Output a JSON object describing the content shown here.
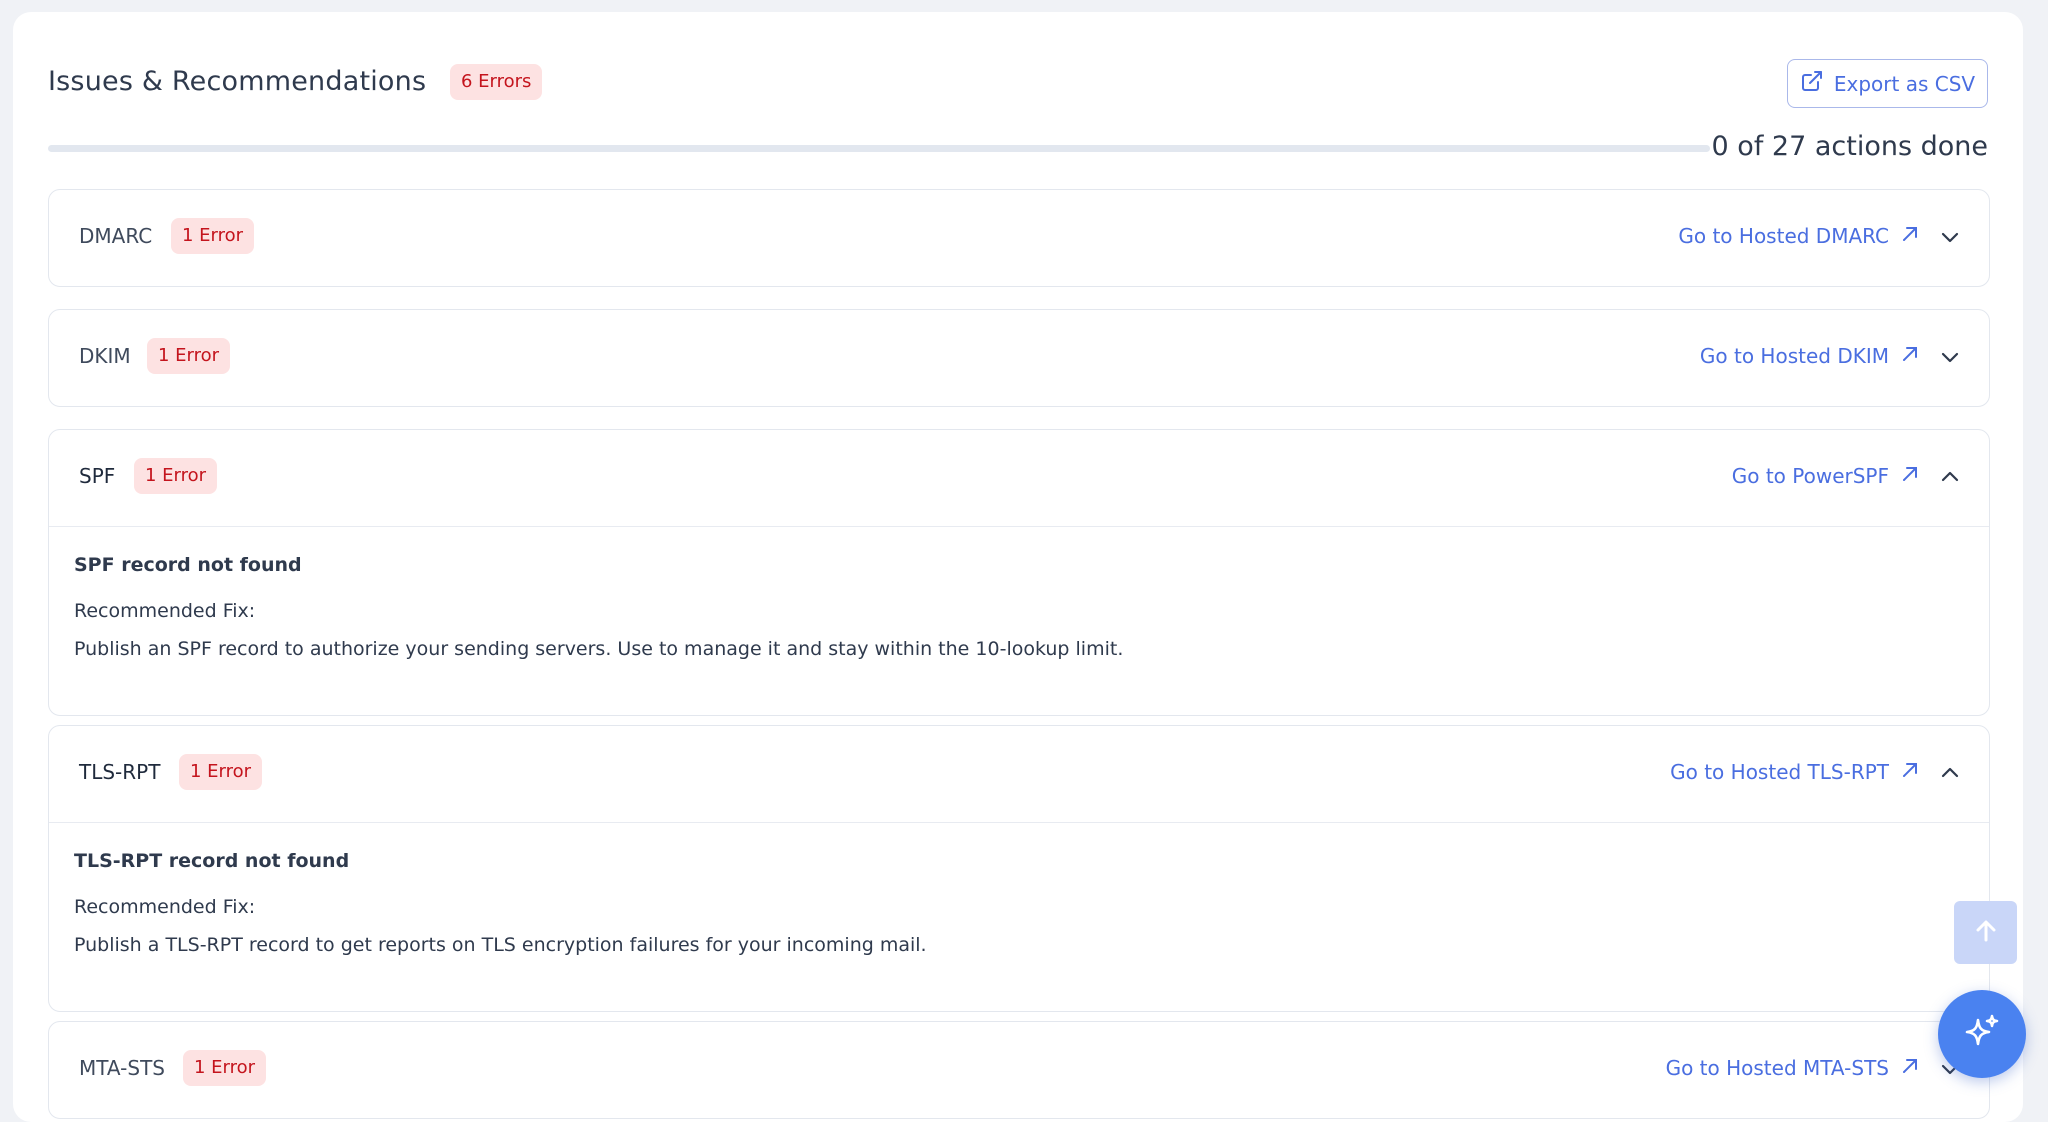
{
  "header": {
    "title": "Issues & Recommendations",
    "errors_badge": "6 Errors",
    "export_label": "Export as CSV"
  },
  "progress": {
    "done": 0,
    "total": 27,
    "fraction": 0,
    "label": "0 of 27 actions done"
  },
  "sections": [
    {
      "name": "DMARC",
      "badge": "1 Error",
      "link": "Go to Hosted DMARC",
      "expanded": false
    },
    {
      "name": "DKIM",
      "badge": "1 Error",
      "link": "Go to Hosted DKIM",
      "expanded": false
    },
    {
      "name": "SPF",
      "badge": "1 Error",
      "link": "Go to PowerSPF",
      "expanded": true,
      "issue_title": "SPF record not found",
      "fix_label": "Recommended Fix:",
      "fix_text": "Publish an SPF record to authorize your sending servers. Use to manage it and stay within the 10-lookup limit."
    },
    {
      "name": "TLS-RPT",
      "badge": "1 Error",
      "link": "Go to Hosted TLS-RPT",
      "expanded": true,
      "issue_title": "TLS-RPT record not found",
      "fix_label": "Recommended Fix:",
      "fix_text": "Publish a TLS-RPT record to get reports on TLS encryption failures for your incoming mail."
    },
    {
      "name": "MTA-STS",
      "badge": "1 Error",
      "link": "Go to Hosted MTA-STS",
      "expanded": false
    }
  ],
  "icons": {
    "export": "external-link-icon",
    "link": "arrow-up-right-icon",
    "collapsed": "chevron-down-icon",
    "expanded": "chevron-up-icon",
    "scroll_top": "arrow-up-icon",
    "ai": "sparkles-icon"
  },
  "colors": {
    "accent": "#4a6ee0",
    "error_bg": "#fde2e2",
    "error_text": "#c4141d",
    "ai_button": "#4a82f0"
  }
}
